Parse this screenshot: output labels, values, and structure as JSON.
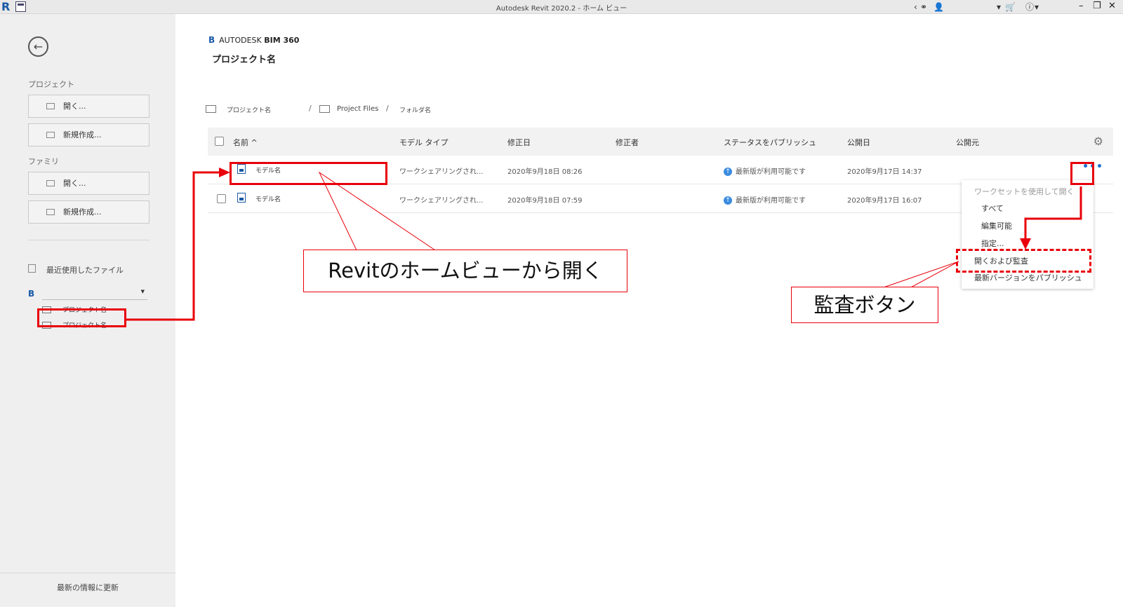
{
  "window": {
    "title": "Autodesk Revit 2020.2 - ホーム ビュー"
  },
  "sidebar": {
    "project_label": "プロジェクト",
    "project_open": "開く...",
    "project_new": "新規作成...",
    "family_label": "ファミリ",
    "family_open": "開く...",
    "family_new": "新規作成...",
    "recent_label": "最近使用したファイル",
    "hub_logo": "B",
    "tree": [
      "プロジェクト名",
      "プロジェクト名"
    ],
    "footer": "最新の情報に更新"
  },
  "main": {
    "brand_mark": "B",
    "brand_prefix": "AUTODESK",
    "brand_name": "BIM 360",
    "project_title": "プロジェクト名",
    "breadcrumb": [
      "プロジェクト名",
      "Project Files",
      "フォルダ名"
    ],
    "columns": [
      "名前 ^",
      "モデル タイプ",
      "修正日",
      "修正者",
      "ステータスをパブリッシュ",
      "公開日",
      "公開元"
    ],
    "rows": [
      {
        "name": "モデル名",
        "type": "ワークシェアリングされ...",
        "modified": "2020年9月18日 08:26",
        "status": "最新版が利用可能です",
        "published": "2020年9月17日 14:37"
      },
      {
        "name": "モデル名",
        "type": "ワークシェアリングされ...",
        "modified": "2020年9月18日 07:59",
        "status": "最新版が利用可能です",
        "published": "2020年9月17日 16:07"
      }
    ],
    "menu": {
      "header": "ワークセットを使用して開く",
      "items": [
        "すべて",
        "編集可能",
        "指定..."
      ],
      "open_audit": "開くおよび監査",
      "publish": "最新バージョンをパブリッシュ"
    }
  },
  "annotations": {
    "callout_open": "Revitのホームビューから開く",
    "callout_audit": "監査ボタン"
  },
  "colors": {
    "annotation": "#e8000a",
    "accent": "#1a5aa6",
    "status": "#3a8be0"
  }
}
